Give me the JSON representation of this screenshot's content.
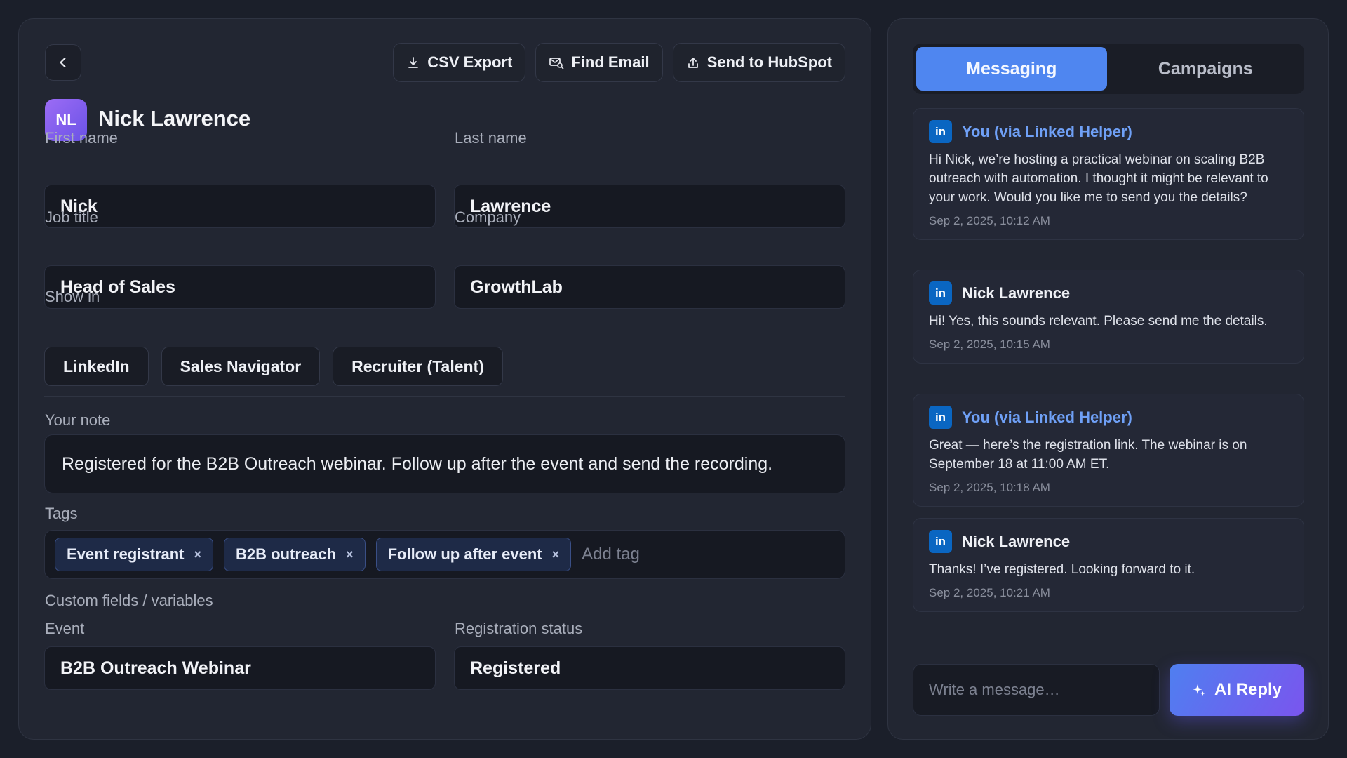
{
  "toolbar": {
    "csv_export": "CSV Export",
    "find_email": "Find Email",
    "send_hubspot": "Send to HubSpot"
  },
  "contact": {
    "initials": "NL",
    "name": "Nick Lawrence"
  },
  "fields": {
    "first_name": {
      "label": "First name",
      "value": "Nick"
    },
    "last_name": {
      "label": "Last name",
      "value": "Lawrence"
    },
    "job_title": {
      "label": "Job title",
      "value": "Head of Sales"
    },
    "company": {
      "label": "Company",
      "value": "GrowthLab"
    }
  },
  "show_in": {
    "label": "Show in",
    "options": [
      "LinkedIn",
      "Sales Navigator",
      "Recruiter (Talent)"
    ]
  },
  "note": {
    "label": "Your note",
    "value": "Registered for the B2B Outreach webinar. Follow up after the event and send the recording."
  },
  "tags": {
    "label": "Tags",
    "items": [
      "Event registrant",
      "B2B outreach",
      "Follow up after event"
    ],
    "remove_glyph": "×",
    "add_placeholder": "Add tag"
  },
  "custom": {
    "label": "Custom fields / variables",
    "event": {
      "label": "Event",
      "value": "B2B Outreach Webinar"
    },
    "status": {
      "label": "Registration status",
      "value": "Registered"
    }
  },
  "tabs": {
    "messaging": "Messaging",
    "campaigns": "Campaigns",
    "active": "messaging"
  },
  "messages": [
    {
      "badge": "in",
      "sender": "You (via Linked Helper)",
      "from_self": true,
      "text": "Hi Nick, we’re hosting a practical webinar on scaling B2B outreach with automation. I thought it might be relevant to your work. Would you like me to send you the details?",
      "time": "Sep 2, 2025, 10:12 AM"
    },
    {
      "badge": "in",
      "sender": "Nick Lawrence",
      "from_self": false,
      "text": "Hi! Yes, this sounds relevant. Please send me the details.",
      "time": "Sep 2, 2025, 10:15 AM"
    },
    {
      "badge": "in",
      "sender": "You (via Linked Helper)",
      "from_self": true,
      "text": "Great — here’s the registration link. The webinar is on September 18 at 11:00 AM ET.",
      "time": "Sep 2, 2025, 10:18 AM"
    },
    {
      "badge": "in",
      "sender": "Nick Lawrence",
      "from_self": false,
      "text": "Thanks! I’ve registered. Looking forward to it.",
      "time": "Sep 2, 2025, 10:21 AM"
    }
  ],
  "compose": {
    "placeholder": "Write a message…",
    "ai_reply": "AI Reply"
  },
  "colors": {
    "background": "#1b1f2a",
    "panel": "#222632",
    "accent": "#4f86f0",
    "linkedin": "#0a66c2",
    "ai_gradient_start": "#4f7ff0",
    "ai_gradient_end": "#7a55ee"
  },
  "icons": {
    "back": "chevron-left-icon",
    "csv": "download-icon",
    "find_email": "search-mail-icon",
    "hubspot": "upload-icon",
    "ai": "sparkle-icon"
  }
}
